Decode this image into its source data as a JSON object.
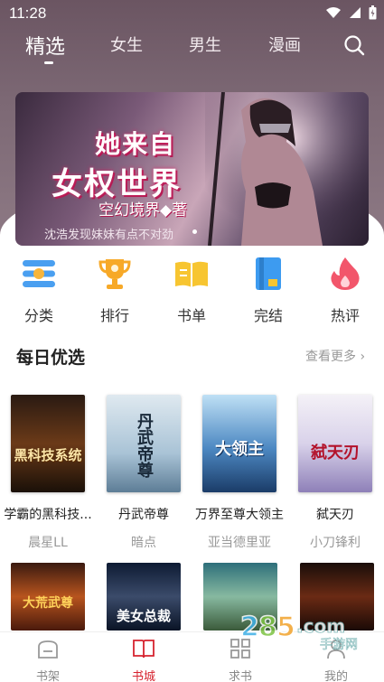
{
  "status": {
    "time": "11:28"
  },
  "nav": {
    "tabs": [
      {
        "label": "精选"
      },
      {
        "label": "女生"
      },
      {
        "label": "男生"
      },
      {
        "label": "漫画"
      }
    ]
  },
  "banner": {
    "title_line1": "她来自",
    "title_line2": "女权世界",
    "author": "空幻境界◆著",
    "subtitle": "沈浩发现妹妹有点不对劲"
  },
  "quick": [
    {
      "label": "分类"
    },
    {
      "label": "排行"
    },
    {
      "label": "书单"
    },
    {
      "label": "完结"
    },
    {
      "label": "热评"
    }
  ],
  "section": {
    "title": "每日优选",
    "more": "查看更多"
  },
  "books": [
    {
      "title": "学霸的黑科技...",
      "author": "晨星LL",
      "cover_text": "黑科技系统"
    },
    {
      "title": "丹武帝尊",
      "author": "暗点",
      "cover_text": "丹武帝尊"
    },
    {
      "title": "万界至尊大领主",
      "author": "亚当德里亚",
      "cover_text": "大领主"
    },
    {
      "title": "弑天刃",
      "author": "小刀锋利",
      "cover_text": "弑天刃"
    }
  ],
  "books_row2": [
    {
      "cover_text": "大荒武尊"
    },
    {
      "cover_text": "美女总裁"
    },
    {
      "cover_text": ""
    },
    {
      "cover_text": ""
    }
  ],
  "bottom": {
    "items": [
      {
        "label": "书架"
      },
      {
        "label": "书城"
      },
      {
        "label": "求书"
      },
      {
        "label": "我的"
      }
    ]
  },
  "colors": {
    "accent": "#d6232f",
    "header": "#7c6874"
  }
}
